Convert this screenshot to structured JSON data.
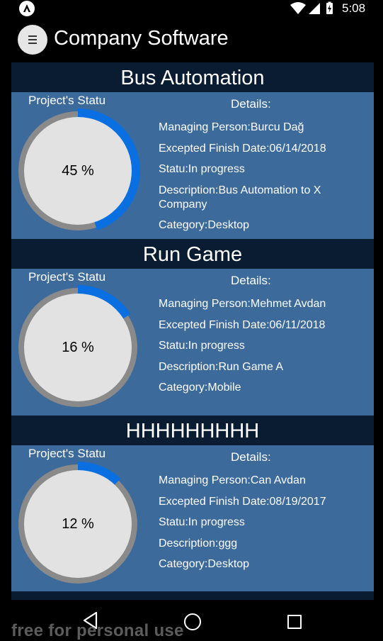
{
  "status_bar": {
    "time": "5:08",
    "icons": [
      "app-notification-icon",
      "wifi-icon",
      "cell-signal-icon",
      "battery-charging-icon"
    ]
  },
  "app_bar": {
    "title": "Company Software",
    "menu_icon": "menu-icon"
  },
  "projects": [
    {
      "name": "Bus Automation",
      "status_label": "Project's Statu",
      "progress": 45,
      "progress_text": "45 %",
      "details_title": "Details:",
      "managing_person": "Managing Person:Burcu Dağ",
      "finish_date": "Excepted Finish Date:06/14/2018",
      "statu": "Statu:In progress",
      "description": "Description:Bus Automation to X Company",
      "category": "Category:Desktop"
    },
    {
      "name": "Run Game",
      "status_label": "Project's Statu",
      "progress": 16,
      "progress_text": "16 %",
      "details_title": "Details:",
      "managing_person": "Managing Person:Mehmet Avdan",
      "finish_date": "Excepted Finish Date:06/11/2018",
      "statu": "Statu:In progress",
      "description": "Description:Run Game A",
      "category": "Category:Mobile"
    },
    {
      "name": "HHHHHHHHH",
      "status_label": "Project's Statu",
      "progress": 12,
      "progress_text": "12 %",
      "details_title": "Details:",
      "managing_person": "Managing Person:Can Avdan",
      "finish_date": "Excepted Finish Date:08/19/2017",
      "statu": "Statu:In progress",
      "description": "Description:ggg",
      "category": "Category:Desktop"
    }
  ],
  "colors": {
    "progress": "#0a6fe0",
    "track": "#8a8a8a",
    "inner": "#e2e2e2",
    "header": "#091c31",
    "card": "#3b6a9b"
  },
  "nav_bar": {
    "icons": [
      "back-icon",
      "home-icon",
      "recent-apps-icon"
    ]
  },
  "watermark": "free for personal use"
}
